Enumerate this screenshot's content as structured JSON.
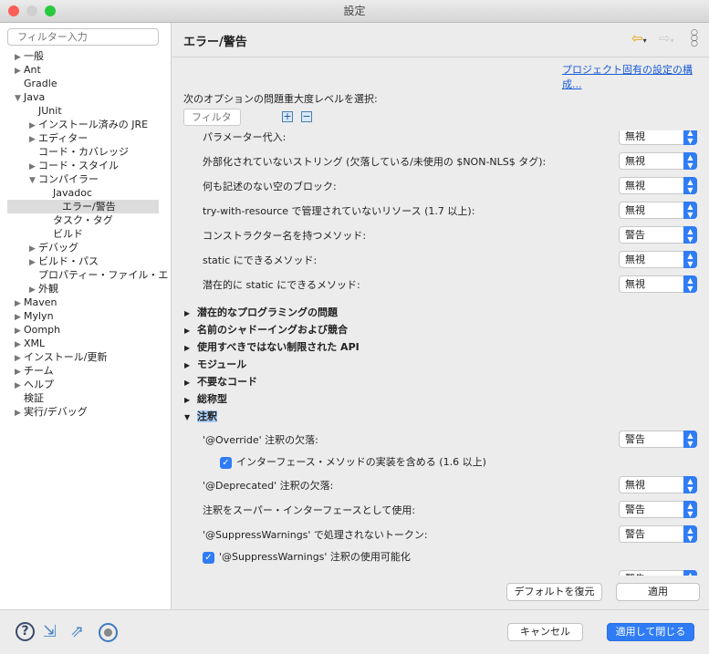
{
  "window": {
    "title": "設定"
  },
  "sidebar": {
    "filter_placeholder": "フィルター入力",
    "items": [
      {
        "label": "一般",
        "level": 0,
        "arrow": "right"
      },
      {
        "label": "Ant",
        "level": 0,
        "arrow": "right"
      },
      {
        "label": "Gradle",
        "level": 0,
        "arrow": ""
      },
      {
        "label": "Java",
        "level": 0,
        "arrow": "down"
      },
      {
        "label": "JUnit",
        "level": 1,
        "arrow": ""
      },
      {
        "label": "インストール済みの JRE",
        "level": 1,
        "arrow": "right"
      },
      {
        "label": "エディター",
        "level": 1,
        "arrow": "right"
      },
      {
        "label": "コード・カバレッジ",
        "level": 1,
        "arrow": ""
      },
      {
        "label": "コード・スタイル",
        "level": 1,
        "arrow": "right"
      },
      {
        "label": "コンパイラー",
        "level": 1,
        "arrow": "down"
      },
      {
        "label": "Javadoc",
        "level": 2,
        "arrow": ""
      },
      {
        "label": "エラー/警告",
        "level": 2,
        "arrow": "",
        "selected": true
      },
      {
        "label": "タスク・タグ",
        "level": 2,
        "arrow": ""
      },
      {
        "label": "ビルド",
        "level": 2,
        "arrow": ""
      },
      {
        "label": "デバッグ",
        "level": 1,
        "arrow": "right"
      },
      {
        "label": "ビルド・パス",
        "level": 1,
        "arrow": "right"
      },
      {
        "label": "プロパティー・ファイル・エ",
        "level": 1,
        "arrow": ""
      },
      {
        "label": "外観",
        "level": 1,
        "arrow": "right"
      },
      {
        "label": "Maven",
        "level": 0,
        "arrow": "right"
      },
      {
        "label": "Mylyn",
        "level": 0,
        "arrow": "right"
      },
      {
        "label": "Oomph",
        "level": 0,
        "arrow": "right"
      },
      {
        "label": "XML",
        "level": 0,
        "arrow": "right"
      },
      {
        "label": "インストール/更新",
        "level": 0,
        "arrow": "right"
      },
      {
        "label": "チーム",
        "level": 0,
        "arrow": "right"
      },
      {
        "label": "ヘルプ",
        "level": 0,
        "arrow": "right"
      },
      {
        "label": "検証",
        "level": 0,
        "arrow": ""
      },
      {
        "label": "実行/デバッグ",
        "level": 0,
        "arrow": "right"
      }
    ]
  },
  "main": {
    "title": "エラー/警告",
    "project_link": "プロジェクト固有の設定の構成...",
    "instruction": "次のオプションの問題重大度レベルを選択:",
    "filter_placeholder": "フィルタ",
    "options": [
      {
        "label": "パラメーター代入:",
        "value": "無視"
      },
      {
        "label": "外部化されていないストリング (欠落している/未使用の $NON-NLS$ タグ):",
        "value": "無視"
      },
      {
        "label": "何も記述のない空のブロック:",
        "value": "無視"
      },
      {
        "label": "try-with-resource で管理されていないリソース (1.7 以上):",
        "value": "無視"
      },
      {
        "label": "コンストラクター名を持つメソッド:",
        "value": "警告"
      },
      {
        "label": "static にできるメソッド:",
        "value": "無視"
      },
      {
        "label": "潜在的に static にできるメソッド:",
        "value": "無視"
      }
    ],
    "sections": [
      "潜在的なプログラミングの問題",
      "名前のシャドーイングおよび競合",
      "使用すべきではない制限された API",
      "モジュール",
      "不要なコード",
      "総称型"
    ],
    "expanded_section": "注釈",
    "annotation": {
      "override": {
        "label": "'@Override' 注釈の欠落:",
        "value": "警告"
      },
      "include_interface": {
        "label": "インターフェース・メソッドの実装を含める (1.6 以上)",
        "checked": true
      },
      "deprecated": {
        "label": "'@Deprecated' 注釈の欠落:",
        "value": "無視"
      },
      "super_interface": {
        "label": "注釈をスーパー・インターフェースとして使用:",
        "value": "警告"
      },
      "unhandled_token": {
        "label": "'@SuppressWarnings' で処理されないトークン:",
        "value": "警告"
      },
      "enable_suppress": {
        "label": "'@SuppressWarnings' 注釈の使用可能化",
        "checked": true
      },
      "partial_value": "警告"
    },
    "restore_defaults": "デフォルトを復元",
    "apply": "適用"
  },
  "footer": {
    "cancel": "キャンセル",
    "apply_close": "適用して閉じる"
  },
  "colors": {
    "accent": "#2f7cf6",
    "link": "#1a5bd6"
  }
}
